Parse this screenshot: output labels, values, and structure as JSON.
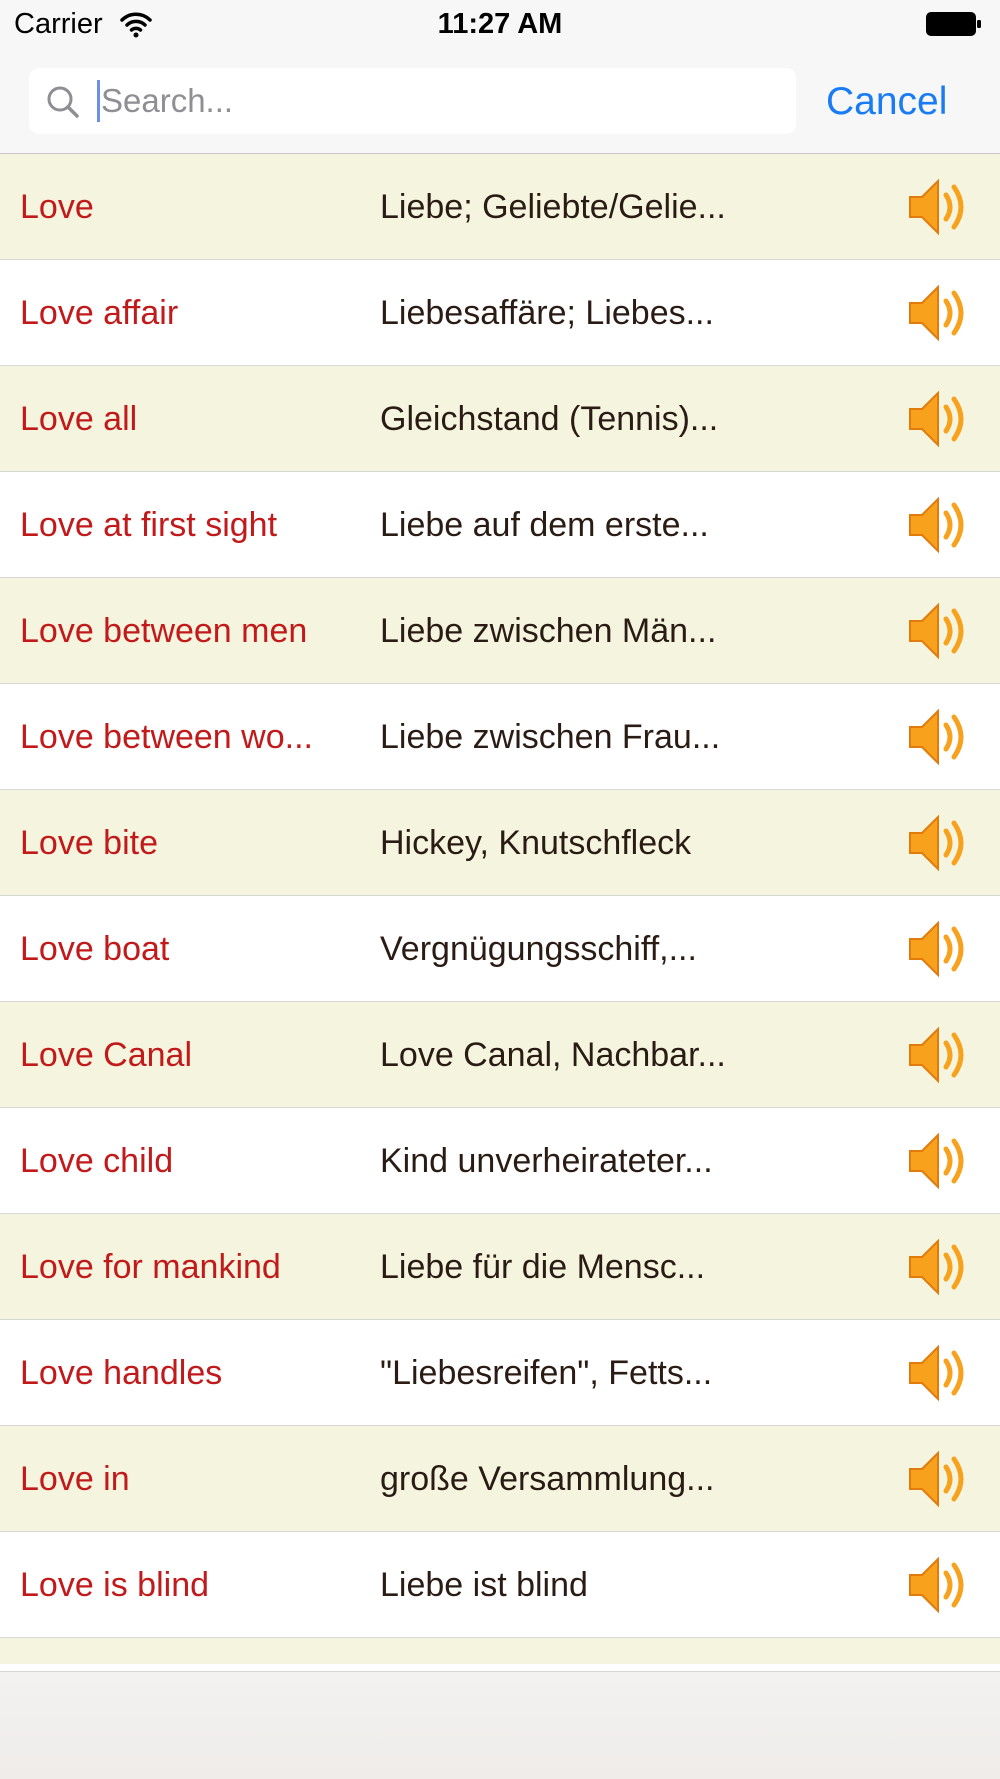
{
  "status_bar": {
    "carrier": "Carrier",
    "time": "11:27 AM"
  },
  "search": {
    "placeholder": "Search...",
    "value": "",
    "cancel_label": "Cancel"
  },
  "colors": {
    "term_text": "#c21a1a",
    "translation_text": "#2a1c14",
    "alt_row_bg": "#f5f5df",
    "accent": "#1a7cf5",
    "speaker": "#f7a11d"
  },
  "entries": [
    {
      "term": "Love",
      "translation": "Liebe; Geliebte/Gelie..."
    },
    {
      "term": "Love affair",
      "translation": "Liebesaffäre; Liebes..."
    },
    {
      "term": "Love all",
      "translation": "Gleichstand (Tennis)..."
    },
    {
      "term": "Love at first sight",
      "translation": "Liebe auf dem erste..."
    },
    {
      "term": "Love between men",
      "translation": "Liebe zwischen Män..."
    },
    {
      "term": "Love between wo...",
      "translation": "Liebe zwischen Frau..."
    },
    {
      "term": "Love bite",
      "translation": "Hickey, Knutschfleck"
    },
    {
      "term": "Love boat",
      "translation": "Vergnügungsschiff,..."
    },
    {
      "term": "Love Canal",
      "translation": "Love Canal, Nachbar..."
    },
    {
      "term": "Love child",
      "translation": "Kind unverheirateter..."
    },
    {
      "term": "Love for mankind",
      "translation": "Liebe für die Mensc..."
    },
    {
      "term": "Love handles",
      "translation": "\"Liebesreifen\", Fetts..."
    },
    {
      "term": "Love in",
      "translation": "große Versammlung..."
    },
    {
      "term": "Love is blind",
      "translation": "Liebe ist blind"
    }
  ]
}
